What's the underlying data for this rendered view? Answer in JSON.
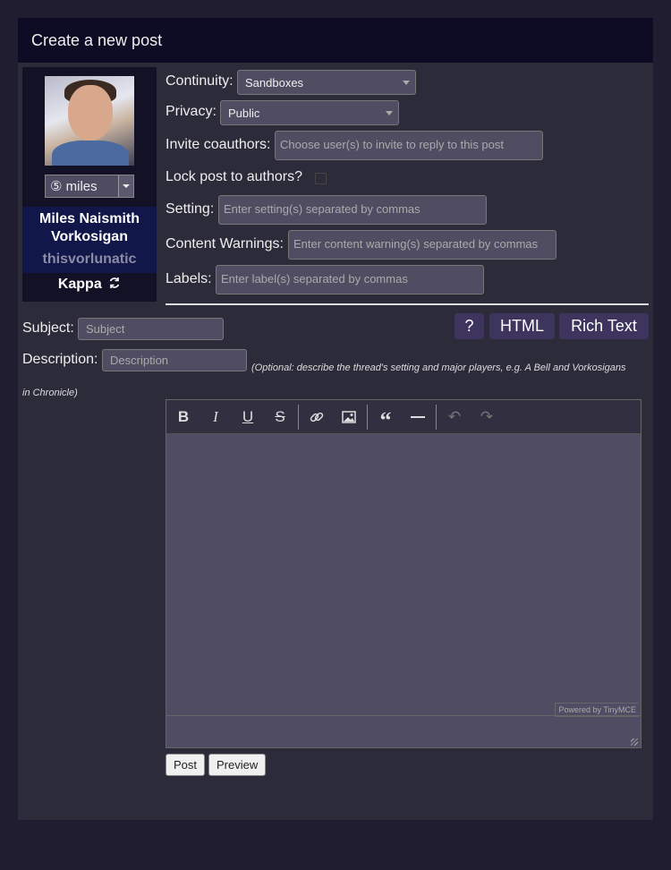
{
  "header": {
    "title": "Create a new post"
  },
  "character": {
    "alias": "⑤ miles",
    "name": "Miles Naismith Vorkosigan",
    "username": "thisvorlunatic",
    "board": "Kappa"
  },
  "form": {
    "continuity_label": "Continuity:",
    "continuity_value": "Sandboxes",
    "privacy_label": "Privacy:",
    "privacy_value": "Public",
    "coauthors_label": "Invite coauthors:",
    "coauthors_placeholder": "Choose user(s) to invite to reply to this post",
    "lock_label": "Lock post to authors?",
    "setting_label": "Setting:",
    "setting_placeholder": "Enter setting(s) separated by commas",
    "warnings_label": "Content Warnings:",
    "warnings_placeholder": "Enter content warning(s) separated by commas",
    "labels_label": "Labels:",
    "labels_placeholder": "Enter label(s) separated by commas",
    "subject_label": "Subject:",
    "subject_placeholder": "Subject",
    "description_label": "Description:",
    "description_placeholder": "Description",
    "description_note": "(Optional: describe the thread's setting and major players, e.g. A Bell and Vorkosigans in Chronicle)"
  },
  "editor_modes": {
    "help": "?",
    "html": "HTML",
    "rich": "Rich Text"
  },
  "editor": {
    "powered_by": "Powered by TinyMCE"
  },
  "buttons": {
    "post": "Post",
    "preview": "Preview"
  }
}
